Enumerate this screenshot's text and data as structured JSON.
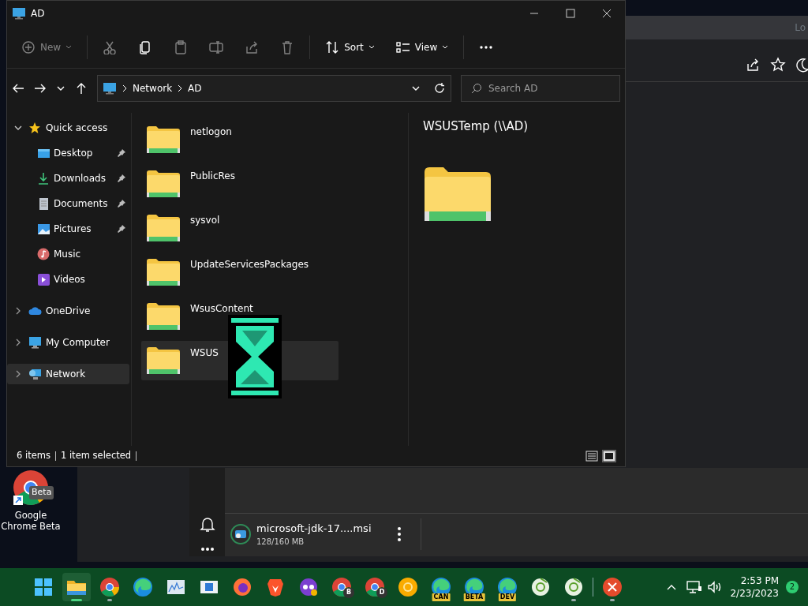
{
  "explorer": {
    "title": "AD",
    "toolbar": [
      {
        "kind": "new",
        "label": "New",
        "disabled": true
      },
      {
        "kind": "cut",
        "disabled": true
      },
      {
        "kind": "copy",
        "disabled": false
      },
      {
        "kind": "paste",
        "disabled": true
      },
      {
        "kind": "rename",
        "disabled": true
      },
      {
        "kind": "share",
        "disabled": true
      },
      {
        "kind": "delete",
        "disabled": true
      },
      {
        "kind": "sort",
        "label": "Sort",
        "disabled": false
      },
      {
        "kind": "view",
        "label": "View",
        "disabled": false
      },
      {
        "kind": "more",
        "disabled": false
      }
    ],
    "breadcrumb": [
      "Network",
      "AD"
    ],
    "search": {
      "placeholder": "Search AD"
    },
    "sidebar": [
      {
        "kind": "star",
        "label": "Quick access",
        "expanded": true,
        "selected": false,
        "children": [
          {
            "kind": "desktop",
            "label": "Desktop",
            "pinned": true,
            "selected": false
          },
          {
            "kind": "downloads",
            "label": "Downloads",
            "pinned": true,
            "selected": false
          },
          {
            "kind": "documents",
            "label": "Documents",
            "pinned": true,
            "selected": false
          },
          {
            "kind": "pictures",
            "label": "Pictures",
            "pinned": true,
            "selected": false
          },
          {
            "kind": "music",
            "label": "Music",
            "pinned": false,
            "selected": false
          },
          {
            "kind": "videos",
            "label": "Videos",
            "pinned": false,
            "selected": false
          }
        ]
      },
      {
        "kind": "cloud",
        "label": "OneDrive",
        "expanded": false,
        "selected": false
      },
      {
        "kind": "computer",
        "label": "My Computer",
        "expanded": false,
        "selected": false
      },
      {
        "kind": "network",
        "label": "Network",
        "expanded": false,
        "selected": true
      }
    ],
    "files": [
      {
        "name": "netlogon",
        "selected": false
      },
      {
        "name": "PublicRes",
        "selected": false
      },
      {
        "name": "sysvol",
        "selected": false
      },
      {
        "name": "UpdateServicesPackages",
        "selected": false
      },
      {
        "name": "WsusContent",
        "selected": false
      },
      {
        "name": "WSUS",
        "selected": true
      }
    ],
    "preview": {
      "title": "WSUSTemp (\\\\AD)"
    },
    "status_bar": {
      "count": "6 items",
      "selection": "1 item selected",
      "views": [
        {
          "kind": "details",
          "selected": false
        },
        {
          "kind": "large",
          "selected": true
        }
      ]
    }
  },
  "desktop_icon": {
    "label": "Google Chrome Beta",
    "badge": "Beta"
  },
  "browser": {
    "tab_text": "Lo"
  },
  "downloads": {
    "file": "microsoft-jdk-17....msi",
    "progress": "128/160 MB"
  },
  "taskbar": {
    "apps": [
      {
        "kind": "start",
        "running": false,
        "active": false
      },
      {
        "kind": "explorer",
        "running": true,
        "active": true
      },
      {
        "kind": "chrome",
        "running": true,
        "active": false
      },
      {
        "kind": "edge",
        "running": false,
        "active": false
      },
      {
        "kind": "monitor",
        "running": false,
        "active": false
      },
      {
        "kind": "media",
        "running": false,
        "active": false
      },
      {
        "kind": "firefox",
        "running": false,
        "active": false
      },
      {
        "kind": "brave",
        "running": false,
        "active": false
      },
      {
        "kind": "incognito",
        "running": false,
        "active": false
      },
      {
        "kind": "chrome",
        "badge": "B",
        "running": false,
        "active": false
      },
      {
        "kind": "chrome",
        "badge": "D",
        "running": false,
        "active": false
      },
      {
        "kind": "canary",
        "running": false,
        "active": false
      },
      {
        "kind": "edge",
        "badge": "CAN",
        "running": false,
        "active": false
      },
      {
        "kind": "edge",
        "badge": "BETA",
        "running": false,
        "active": false
      },
      {
        "kind": "edge",
        "badge": "DEV",
        "running": false,
        "active": false
      },
      {
        "kind": "disc",
        "running": false,
        "active": false
      },
      {
        "kind": "disc",
        "running": true,
        "active": false
      },
      {
        "kind": "close",
        "running": true,
        "active": false
      }
    ],
    "time": "2:53 PM",
    "date": "2/23/2023",
    "notifications": "2"
  }
}
